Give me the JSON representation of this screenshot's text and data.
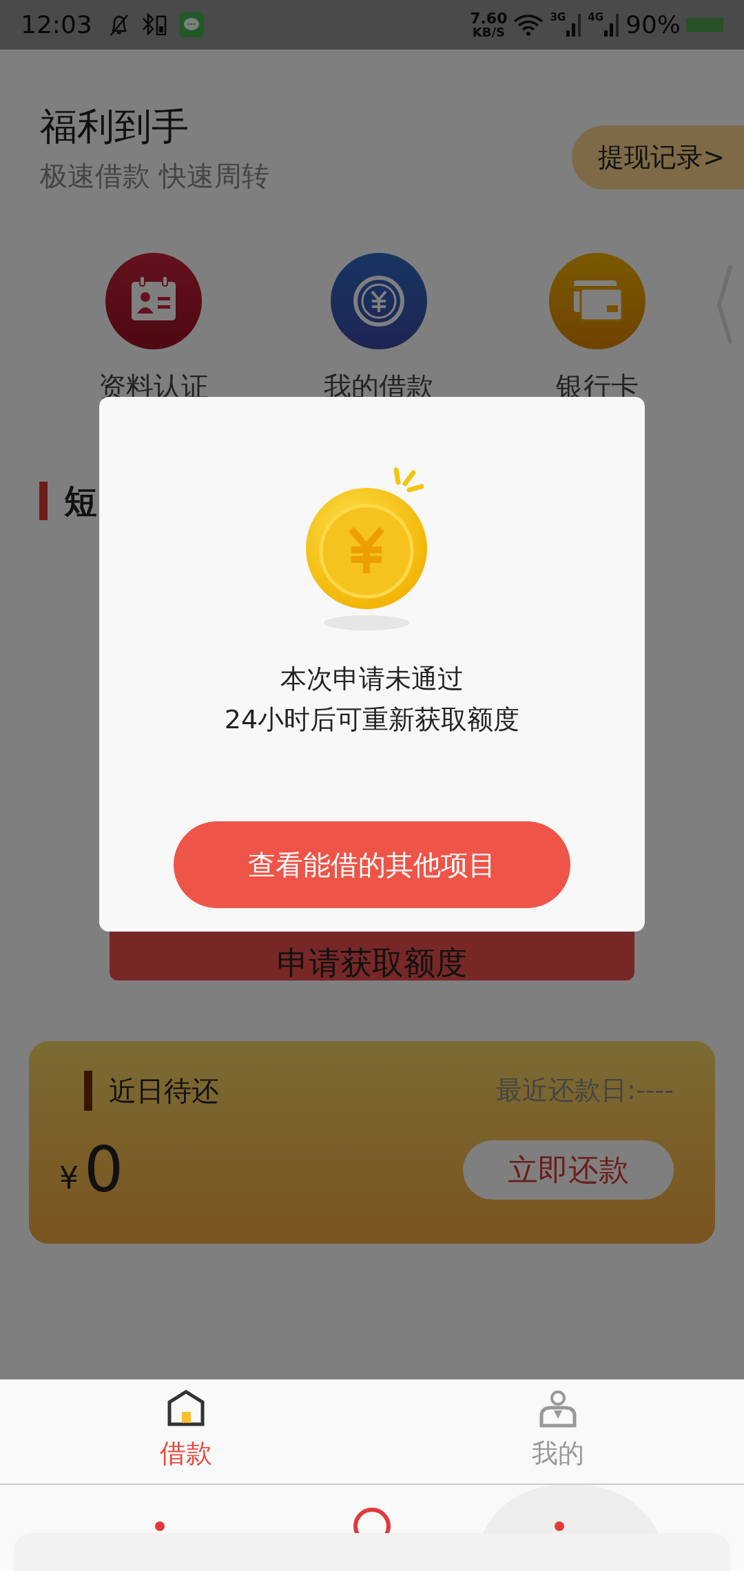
{
  "status_bar": {
    "time": "12:03",
    "net_speed": "7.60",
    "net_speed_unit": "KB/S",
    "signal_1": "3G",
    "signal_2": "4G",
    "battery": "90%"
  },
  "header": {
    "title": "福利到手",
    "subtitle": "极速借款 快速周转",
    "record_button": "提现记录>"
  },
  "shortcuts": [
    {
      "label": "资料认证",
      "kind": "id-card"
    },
    {
      "label": "我的借款",
      "kind": "coin"
    },
    {
      "label": "银行卡",
      "kind": "card"
    }
  ],
  "section_title": "短",
  "apply_button": "申请获取额度",
  "repay_card": {
    "title": "近日待还",
    "due_date": "最近还款日:----",
    "currency": "¥",
    "amount": "0",
    "button": "立即还款"
  },
  "dialog": {
    "line_1": "本次申请未通过",
    "line_2": "24小时后可重新获取额度",
    "button": "查看能借的其他项目"
  },
  "tabs": [
    {
      "label": "借款",
      "kind": "home",
      "selected": true
    },
    {
      "label": "我的",
      "kind": "person",
      "selected": false
    }
  ]
}
